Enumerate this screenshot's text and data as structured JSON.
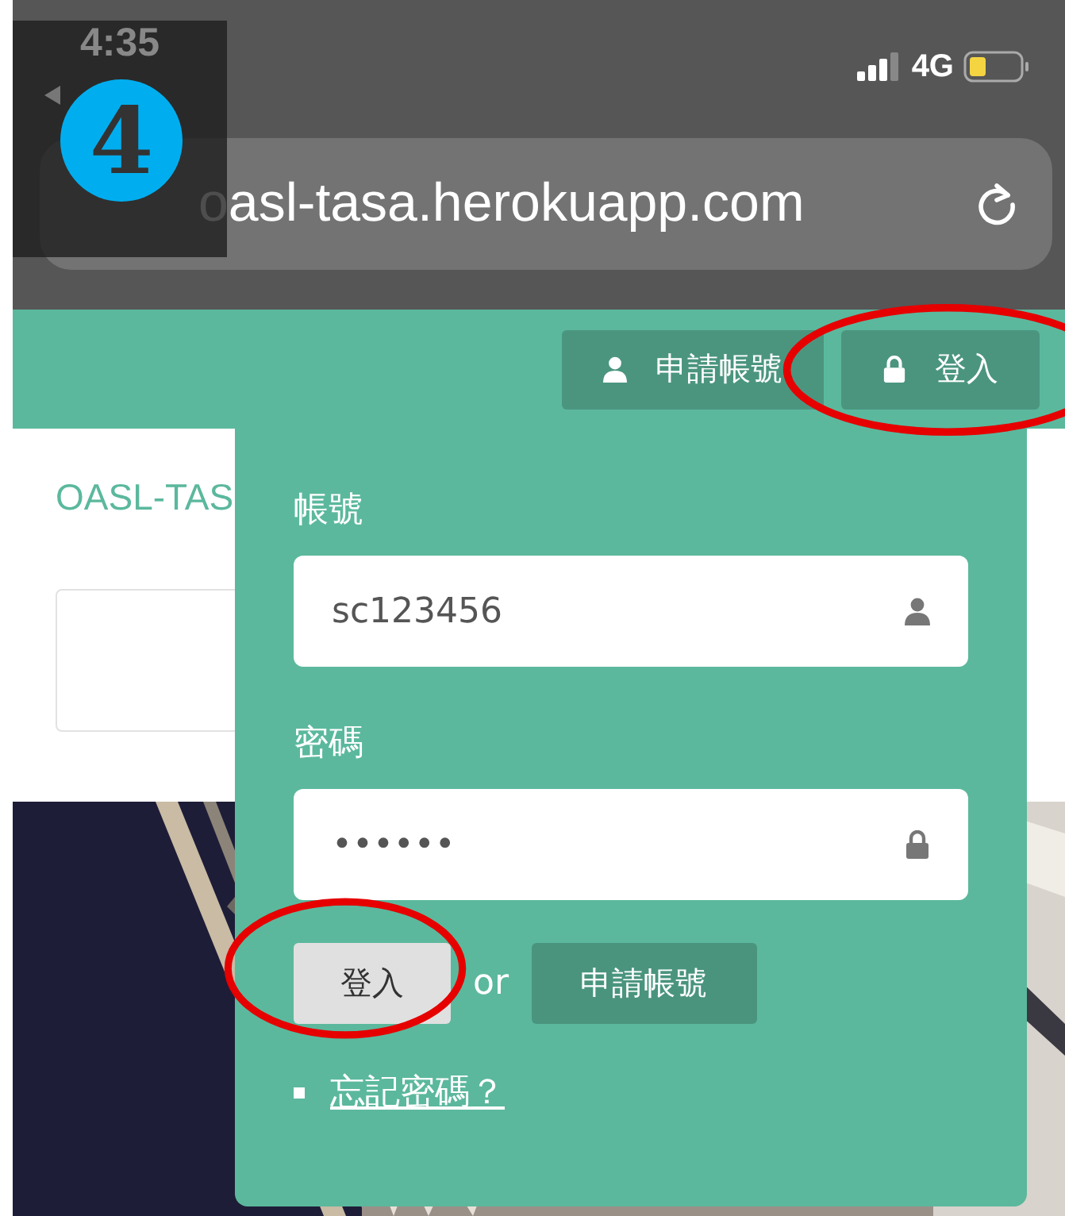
{
  "annotation": {
    "step": "4"
  },
  "status_bar": {
    "time": "4:35",
    "network": "4G"
  },
  "address_bar": {
    "url": "oasl-tasa.herokuapp.com"
  },
  "navbar": {
    "buttons": [
      {
        "label": "申請帳號",
        "circled": false
      },
      {
        "label": "登入",
        "circled": true
      }
    ]
  },
  "page": {
    "brand": "OASL-TAS"
  },
  "login_dropdown": {
    "fields": [
      {
        "label": "帳號",
        "value": "sc123456"
      },
      {
        "label": "密碼",
        "value": "••••••"
      }
    ],
    "submit": {
      "label": "登入",
      "circled": true
    },
    "or": "or",
    "register": "申請帳號",
    "forgot": "忘記密碼？"
  }
}
